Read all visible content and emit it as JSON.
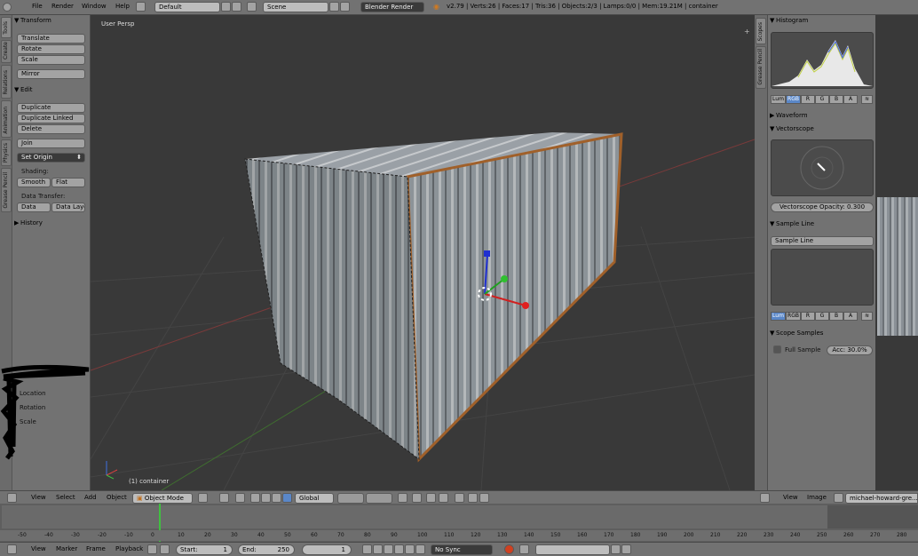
{
  "topbar": {
    "menus": [
      "File",
      "Render",
      "Window",
      "Help"
    ],
    "screen_layout": "Default",
    "scene": "Scene",
    "render_engine": "Blender Render",
    "stats": "v2.79 | Verts:26 | Faces:17 | Tris:36 | Objects:2/3 | Lamps:0/0 | Mem:19.21M | container"
  },
  "left_tabs": [
    "Tools",
    "Create",
    "Relations",
    "Animation",
    "Physics",
    "Grease Pencil"
  ],
  "toolshelf": {
    "transform_header": "Transform",
    "translate": "Translate",
    "rotate": "Rotate",
    "scale": "Scale",
    "mirror": "Mirror",
    "edit_header": "Edit",
    "duplicate": "Duplicate",
    "duplicate_linked": "Duplicate Linked",
    "delete": "Delete",
    "join": "Join",
    "set_origin": "Set Origin",
    "shading_label": "Shading:",
    "smooth": "Smooth",
    "flat": "Flat",
    "data_transfer_label": "Data Transfer:",
    "data": "Data",
    "data_layo": "Data Layo",
    "history_header": "History",
    "location": "Location",
    "rotation": "Rotation",
    "scale2": "Scale"
  },
  "viewport": {
    "persp_label": "User Persp",
    "object_label": "(1) container"
  },
  "right_tabs": [
    "Scopes",
    "Grease Pencil"
  ],
  "scopes": {
    "histogram": "Histogram",
    "channels": [
      "Lum",
      "RGB",
      "R",
      "G",
      "B",
      "A"
    ],
    "waveform": "Waveform",
    "vectorscope": "Vectorscope",
    "vs_opacity_label": "Vectorscope Opacity:",
    "vs_opacity": "0.300",
    "sample_line_header": "Sample Line",
    "sample_line_button": "Sample Line",
    "scope_samples": "Scope Samples",
    "full_sample": "Full Sample",
    "accuracy": "Acc: 30.0%"
  },
  "view3d_header": {
    "menus": [
      "View",
      "Select",
      "Add",
      "Object"
    ],
    "mode": "Object Mode",
    "orientation": "Global"
  },
  "image_header": {
    "menus": [
      "View",
      "Image"
    ],
    "image_name": "michael-howard-gre..."
  },
  "timeline": {
    "frames": [
      "-50",
      "-40",
      "-30",
      "-20",
      "-10",
      "0",
      "10",
      "20",
      "30",
      "40",
      "50",
      "60",
      "70",
      "80",
      "90",
      "100",
      "110",
      "120",
      "130",
      "140",
      "150",
      "160",
      "170",
      "180",
      "190",
      "200",
      "210",
      "220",
      "230",
      "240",
      "250",
      "260",
      "270",
      "280"
    ]
  },
  "bottombar": {
    "menus": [
      "View",
      "Marker",
      "Frame",
      "Playback"
    ],
    "start_label": "Start:",
    "start": "1",
    "end_label": "End:",
    "end": "250",
    "current": "1",
    "sync": "No Sync"
  }
}
